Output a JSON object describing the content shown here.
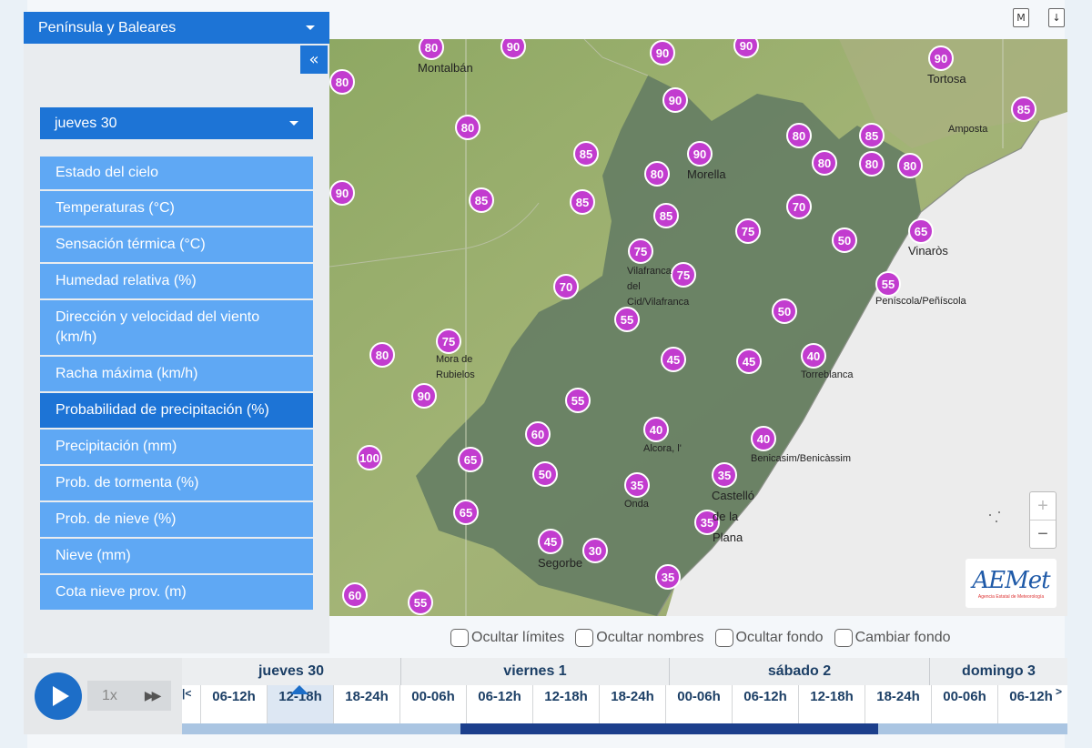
{
  "header": {
    "region": "Península y Baleares",
    "collapse_icon": "«",
    "pdf_icon": "M",
    "download_icon": "↓"
  },
  "sidebar": {
    "day": "jueves 30",
    "variables": [
      {
        "label": "Estado del cielo",
        "active": false
      },
      {
        "label": "Temperaturas (°C)",
        "active": false
      },
      {
        "label": "Sensación térmica (°C)",
        "active": false
      },
      {
        "label": "Humedad relativa (%)",
        "active": false
      },
      {
        "label": "Dirección y velocidad del viento (km/h)",
        "active": false
      },
      {
        "label": "Racha máxima (km/h)",
        "active": false
      },
      {
        "label": "Probabilidad de precipitación (%)",
        "active": true
      },
      {
        "label": "Precipitación (mm)",
        "active": false
      },
      {
        "label": "Prob. de tormenta (%)",
        "active": false
      },
      {
        "label": "Prob. de nieve (%)",
        "active": false
      },
      {
        "label": "Nieve (mm)",
        "active": false
      },
      {
        "label": "Cota nieve prov. (m)",
        "active": false
      }
    ]
  },
  "map": {
    "markers": [
      "80",
      "90",
      "90",
      "90",
      "80",
      "90",
      "80",
      "90",
      "85",
      "80",
      "85",
      "85",
      "90",
      "85",
      "80",
      "80",
      "80",
      "90",
      "85",
      "85",
      "80",
      "70",
      "75",
      "50",
      "65",
      "75",
      "70",
      "75",
      "55",
      "55",
      "50",
      "80",
      "75",
      "45",
      "45",
      "40",
      "90",
      "55",
      "60",
      "40",
      "40",
      "100",
      "65",
      "50",
      "35",
      "35",
      "65",
      "35",
      "45",
      "30",
      "35",
      "60",
      "55"
    ],
    "places": [
      "Montalbán",
      "Tortosa",
      "Amposta",
      "Morella",
      "Vinaròs",
      "Vilafranca",
      "del",
      "Cid/Vilafranca",
      "Peníscola/Peñíscola",
      "Mora de",
      "Rubielos",
      "Torreblanca",
      "Alcora, l'",
      "Benicasim/Benicàssim",
      "Onda",
      "Castelló",
      "de la",
      "Plana",
      "Segorbe"
    ],
    "zoom_in": "+",
    "zoom_out": "−",
    "logo_main": "AEMet",
    "logo_sub": "Agencia Estatal de Meteorología"
  },
  "options": [
    "Ocultar límites",
    "Ocultar nombres",
    "Ocultar fondo",
    "Cambiar fondo"
  ],
  "timeline": {
    "speed": "1x",
    "ff_icon": "▶▶",
    "prev_icon": "|<",
    "next_icon": ">",
    "days": [
      "jueves 30",
      "viernes 1",
      "sábado 2",
      "domingo 3"
    ],
    "slots": [
      "06-12h",
      "12-18h",
      "18-24h",
      "00-06h",
      "06-12h",
      "12-18h",
      "18-24h",
      "00-06h",
      "06-12h",
      "12-18h",
      "18-24h",
      "00-06h",
      "06-12h"
    ],
    "active_slot": 1
  },
  "colors": {
    "accent": "#1d74d6",
    "active_item": "#1d74d6",
    "item": "#5fa8f4",
    "marker": "#c23ccf"
  }
}
